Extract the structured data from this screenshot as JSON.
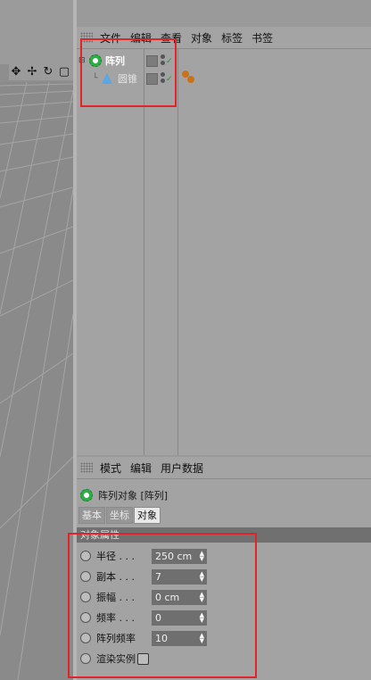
{
  "viewport": {
    "toolbar_icons": [
      "move-icon",
      "arrows-icon",
      "rotate-icon",
      "maximize-icon"
    ],
    "toolbar_glyphs": [
      "✥",
      "✢",
      "↻",
      "▢"
    ]
  },
  "object_manager": {
    "menu": [
      "文件",
      "编辑",
      "查看",
      "对象",
      "标签",
      "书签"
    ],
    "objects": [
      {
        "name": "阵列",
        "icon": "array-icon",
        "level": 0
      },
      {
        "name": "圆锥",
        "icon": "cone-icon",
        "level": 1
      }
    ]
  },
  "attribute_manager": {
    "menu": [
      "模式",
      "编辑",
      "用户数据"
    ],
    "object_title": "阵列对象 [阵列]",
    "tabs": [
      {
        "label": "基本",
        "active": false
      },
      {
        "label": "坐标",
        "active": false
      },
      {
        "label": "对象",
        "active": true
      }
    ],
    "section": "对象属性",
    "properties": [
      {
        "label": "半径 . . .",
        "value": "250 cm"
      },
      {
        "label": "副本 . . .",
        "value": "7"
      },
      {
        "label": "振幅 . . .",
        "value": "0 cm"
      },
      {
        "label": "频率 . . .",
        "value": "0"
      },
      {
        "label": "阵列频率",
        "value": "10"
      }
    ],
    "render_instances_label": "渲染实例"
  },
  "colors": {
    "highlight": "#e0242a",
    "check": "#1e9a2a"
  }
}
